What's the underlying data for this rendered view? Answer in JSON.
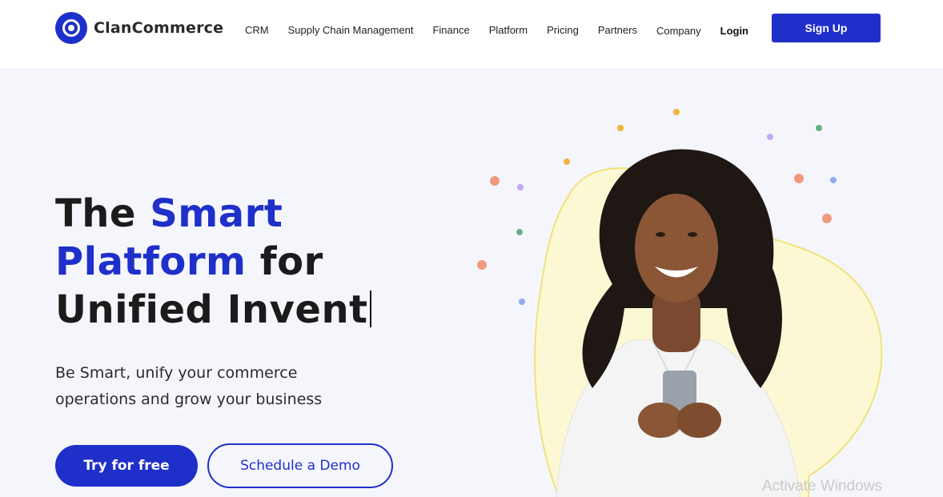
{
  "brand": {
    "name": "ClanCommerce",
    "logo_icon": "clan-logo-icon",
    "primary_color": "#1f2fc9"
  },
  "nav": {
    "items": [
      {
        "label": "CRM"
      },
      {
        "label": "Supply Chain Management"
      },
      {
        "label": "Finance"
      },
      {
        "label": "Platform"
      },
      {
        "label": "Pricing"
      },
      {
        "label": "Partners"
      },
      {
        "label": "Company"
      }
    ],
    "login_label": "Login",
    "signup_label": "Sign Up"
  },
  "hero": {
    "headline": {
      "part1": "The ",
      "accent1": "Smart",
      "accent2": "Platform",
      "part2": " for",
      "line3": "Unified Invent"
    },
    "subtext": "Be Smart, unify your commerce operations and grow your business",
    "cta_primary": "Try for free",
    "cta_secondary": "Schedule a Demo",
    "image": "woman-smiling-holding-phone-photo"
  },
  "overlay": {
    "watermark": "Activate Windows"
  }
}
